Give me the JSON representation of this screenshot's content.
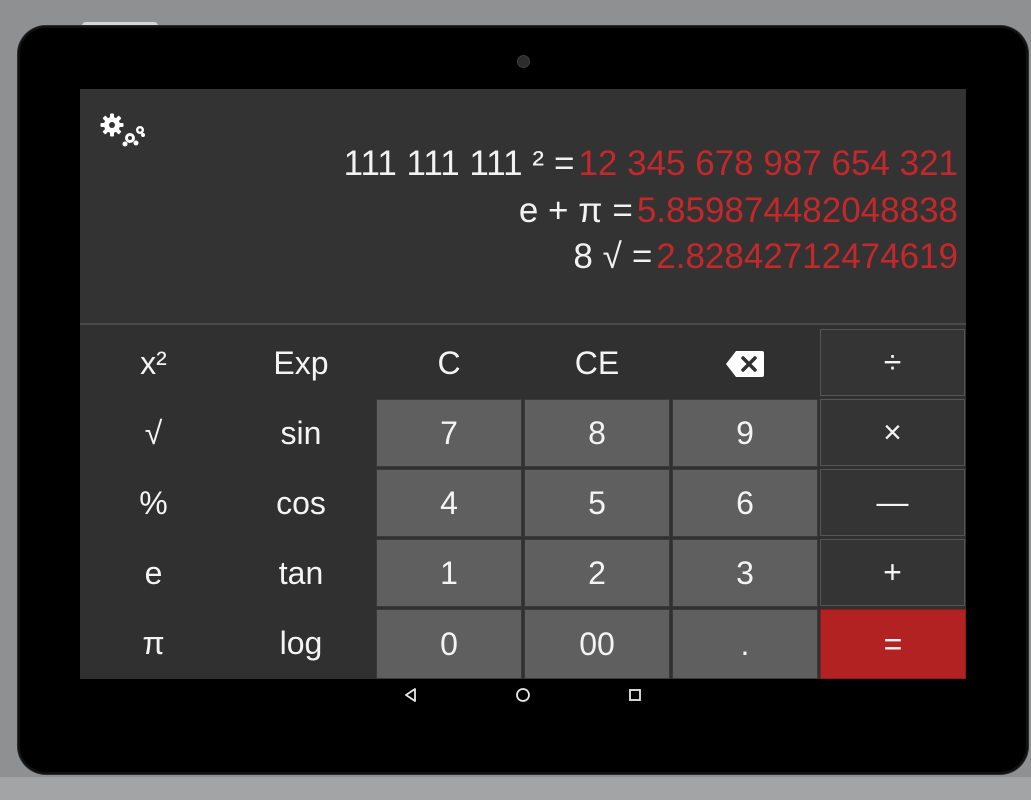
{
  "history": [
    {
      "expression": "111 111 111 ²",
      "equals": "=",
      "result": "12 345 678 987 654 321"
    },
    {
      "expression": "e  +  π",
      "equals": "=",
      "result": "5.859874482048838"
    },
    {
      "expression": "8 √",
      "equals": "=",
      "result": "2.82842712474619"
    }
  ],
  "keypad": {
    "row1": {
      "c0": "x²",
      "c1": "Exp",
      "c2": "C",
      "c3": "CE",
      "c5": "÷"
    },
    "row2": {
      "c0": "√",
      "c1": "sin",
      "c2": "7",
      "c3": "8",
      "c4": "9",
      "c5": "×"
    },
    "row3": {
      "c0": "%",
      "c1": "cos",
      "c2": "4",
      "c3": "5",
      "c4": "6",
      "c5": "—"
    },
    "row4": {
      "c0": "e",
      "c1": "tan",
      "c2": "1",
      "c3": "2",
      "c4": "3",
      "c5": "+"
    },
    "row5": {
      "c0": "π",
      "c1": "log",
      "c2": "0",
      "c3": "00",
      "c4": ".",
      "c5": "="
    }
  },
  "icons": {
    "settings": "gear-icon",
    "backspace": "backspace-icon",
    "nav_back": "back-icon",
    "nav_home": "home-icon",
    "nav_recents": "recents-icon"
  },
  "colors": {
    "result": "#c4282a",
    "equals_key": "#b22222",
    "number_key": "#5f5f5f",
    "display_bg": "#333333"
  }
}
